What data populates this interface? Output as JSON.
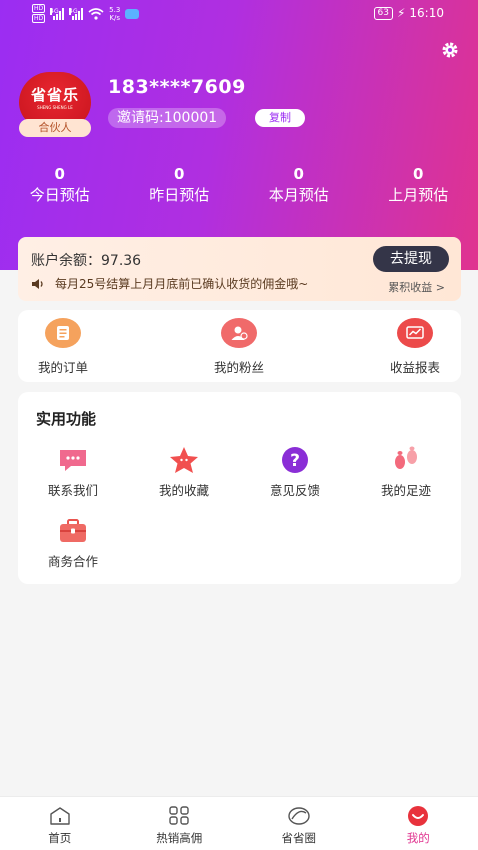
{
  "status_bar": {
    "hd_top": "HD",
    "hd_bottom": "HD",
    "sig1": "4G",
    "sig2": "4G",
    "speed_value": "5.3",
    "speed_unit": "K/s",
    "battery": "63",
    "time": "16:10"
  },
  "profile": {
    "avatar_logo": "省省乐",
    "avatar_sub": "SHENG SHENG LE",
    "role_badge": "合伙人",
    "phone": "183****7609",
    "invite_code": "邀请码:100001",
    "copy_label": "复制"
  },
  "stats": [
    {
      "value": "0",
      "label": "今日预估"
    },
    {
      "value": "0",
      "label": "昨日预估"
    },
    {
      "value": "0",
      "label": "本月预估"
    },
    {
      "value": "0",
      "label": "上月预估"
    }
  ],
  "balance": {
    "text": "账户余额：97.36",
    "withdraw_label": "去提现",
    "notice": "每月25号结算上月月底前已确认收货的佣金哦~",
    "cumulative_label": "累积收益 >"
  },
  "orders": [
    {
      "label": "我的订单",
      "icon": "order-list-icon",
      "color": "#f5a25d"
    },
    {
      "label": "我的粉丝",
      "icon": "fans-icon",
      "color": "#f06a6a"
    },
    {
      "label": "收益报表",
      "icon": "report-icon",
      "color": "#ec4a4a"
    }
  ],
  "tools": {
    "title": "实用功能",
    "items": [
      {
        "label": "联系我们",
        "icon": "chat-icon"
      },
      {
        "label": "我的收藏",
        "icon": "star-icon"
      },
      {
        "label": "意见反馈",
        "icon": "question-icon"
      },
      {
        "label": "我的足迹",
        "icon": "footprint-icon"
      },
      {
        "label": "商务合作",
        "icon": "briefcase-icon"
      }
    ]
  },
  "tabbar": [
    {
      "label": "首页",
      "icon": "home-icon",
      "active": false
    },
    {
      "label": "热销高佣",
      "icon": "grid-icon",
      "active": false
    },
    {
      "label": "省省圈",
      "icon": "circle-leaf-icon",
      "active": false
    },
    {
      "label": "我的",
      "icon": "profile-icon",
      "active": true
    }
  ]
}
